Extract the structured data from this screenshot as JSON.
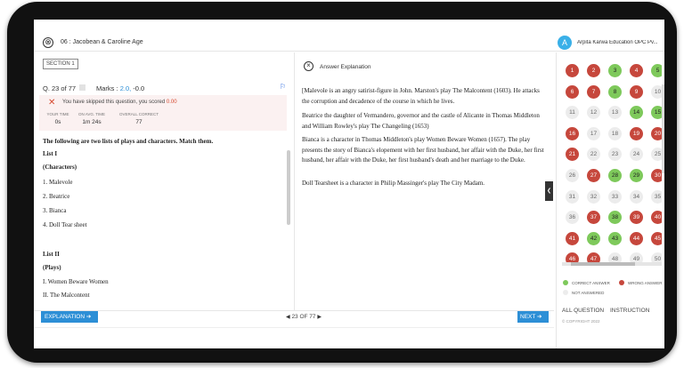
{
  "header": {
    "close_icon": "⊗",
    "topic": "06 : Jacobean & Caroline Age",
    "org_initial": "A",
    "org_name": "Arpita Karwa Education OPC Pv..."
  },
  "question": {
    "section": "SECTION 1",
    "number": "Q. 23 of 77",
    "marks_label": "Marks :",
    "marks_pos": "2.0,",
    "marks_neg": "-0.0",
    "skip_message": "You have skipped this question, you scored",
    "score": "0.00",
    "stats": [
      {
        "label": "YOUR TIME",
        "value": "0s"
      },
      {
        "label": "ON AVG. TIME",
        "value": "1m 24s"
      },
      {
        "label": "OVERALL CORRECT",
        "value": "77"
      }
    ],
    "lines": [
      {
        "text": "The following are two lists of plays and characters. Match them.",
        "bold": true
      },
      {
        "text": "List I",
        "bold": true
      },
      {
        "text": "(Characters)",
        "bold": true
      },
      {
        "text": "1. Malevole",
        "bold": false
      },
      {
        "text": "2. Beatrice",
        "bold": false
      },
      {
        "text": "3. Bianca",
        "bold": false
      },
      {
        "text": "4. Doll Tear sheet",
        "bold": false
      },
      {
        "text": "List II",
        "bold": true
      },
      {
        "text": "(Plays)",
        "bold": true
      },
      {
        "text": "I. Women Beware Women",
        "bold": false
      },
      {
        "text": "II. The Malcontent",
        "bold": false
      }
    ]
  },
  "explanation": {
    "title": "Answer Explanation",
    "paragraphs": [
      "[Malevole is an angry satirist-figure in John. Marston's play The Malcontent (1603). He attacks the corruption and decadence of the course in which he lives.",
      "Beatrice the daughter of Vermandero, governor and the castle of Alicante in Thomas Middleton and William Rowley's play The Changeling (1653)",
      "Bianca is a character in Thomas Middleton's play Women Beware Women (1657). The play presents the story of Bianca's elopement with her first husband, her affair with the Duke, her first husband, her affair with the Duke, her first husband's death and her marriage to the Duke.",
      "Doll Tearsheet is a character in Philip Massinger's play The City Madam."
    ]
  },
  "palette": {
    "questions": [
      {
        "n": "1",
        "s": "wrong"
      },
      {
        "n": "2",
        "s": "wrong"
      },
      {
        "n": "3",
        "s": "correct"
      },
      {
        "n": "4",
        "s": "wrong"
      },
      {
        "n": "5",
        "s": "correct"
      },
      {
        "n": "6",
        "s": "wrong"
      },
      {
        "n": "7",
        "s": "wrong"
      },
      {
        "n": "8",
        "s": "correct"
      },
      {
        "n": "9",
        "s": "wrong"
      },
      {
        "n": "10",
        "s": "none"
      },
      {
        "n": "11",
        "s": "none"
      },
      {
        "n": "12",
        "s": "none"
      },
      {
        "n": "13",
        "s": "none"
      },
      {
        "n": "14",
        "s": "correct"
      },
      {
        "n": "15",
        "s": "correct"
      },
      {
        "n": "16",
        "s": "wrong"
      },
      {
        "n": "17",
        "s": "none"
      },
      {
        "n": "18",
        "s": "none"
      },
      {
        "n": "19",
        "s": "wrong"
      },
      {
        "n": "20",
        "s": "wrong"
      },
      {
        "n": "21",
        "s": "wrong"
      },
      {
        "n": "22",
        "s": "none"
      },
      {
        "n": "23",
        "s": "none"
      },
      {
        "n": "24",
        "s": "none"
      },
      {
        "n": "25",
        "s": "none"
      },
      {
        "n": "26",
        "s": "none"
      },
      {
        "n": "27",
        "s": "wrong"
      },
      {
        "n": "28",
        "s": "correct"
      },
      {
        "n": "29",
        "s": "correct"
      },
      {
        "n": "30",
        "s": "wrong"
      },
      {
        "n": "31",
        "s": "none"
      },
      {
        "n": "32",
        "s": "none"
      },
      {
        "n": "33",
        "s": "none"
      },
      {
        "n": "34",
        "s": "none"
      },
      {
        "n": "35",
        "s": "none"
      },
      {
        "n": "36",
        "s": "none"
      },
      {
        "n": "37",
        "s": "wrong"
      },
      {
        "n": "38",
        "s": "correct"
      },
      {
        "n": "39",
        "s": "wrong"
      },
      {
        "n": "40",
        "s": "wrong"
      },
      {
        "n": "41",
        "s": "wrong"
      },
      {
        "n": "42",
        "s": "correct"
      },
      {
        "n": "43",
        "s": "correct"
      },
      {
        "n": "44",
        "s": "wrong"
      },
      {
        "n": "45",
        "s": "wrong"
      },
      {
        "n": "46",
        "s": "wrong"
      },
      {
        "n": "47",
        "s": "wrong"
      },
      {
        "n": "48",
        "s": "none"
      },
      {
        "n": "49",
        "s": "none"
      },
      {
        "n": "50",
        "s": "none"
      }
    ],
    "legend_correct": "CORRECT ANSWER",
    "legend_wrong": "WRONG ANSWER",
    "legend_none": "NOT ANSWERED",
    "all_questions": "ALL QUESTION",
    "instructions": "INSTRUCTION",
    "copyright": "© COPYRIGHT 2022"
  },
  "footer": {
    "explanation_btn": "EXPLANATION",
    "pager": "23 OF 77",
    "next_btn": "NEXT"
  },
  "colors": {
    "accent": "#2d8fd6",
    "correct": "#7ec95b",
    "wrong": "#c6473c"
  }
}
